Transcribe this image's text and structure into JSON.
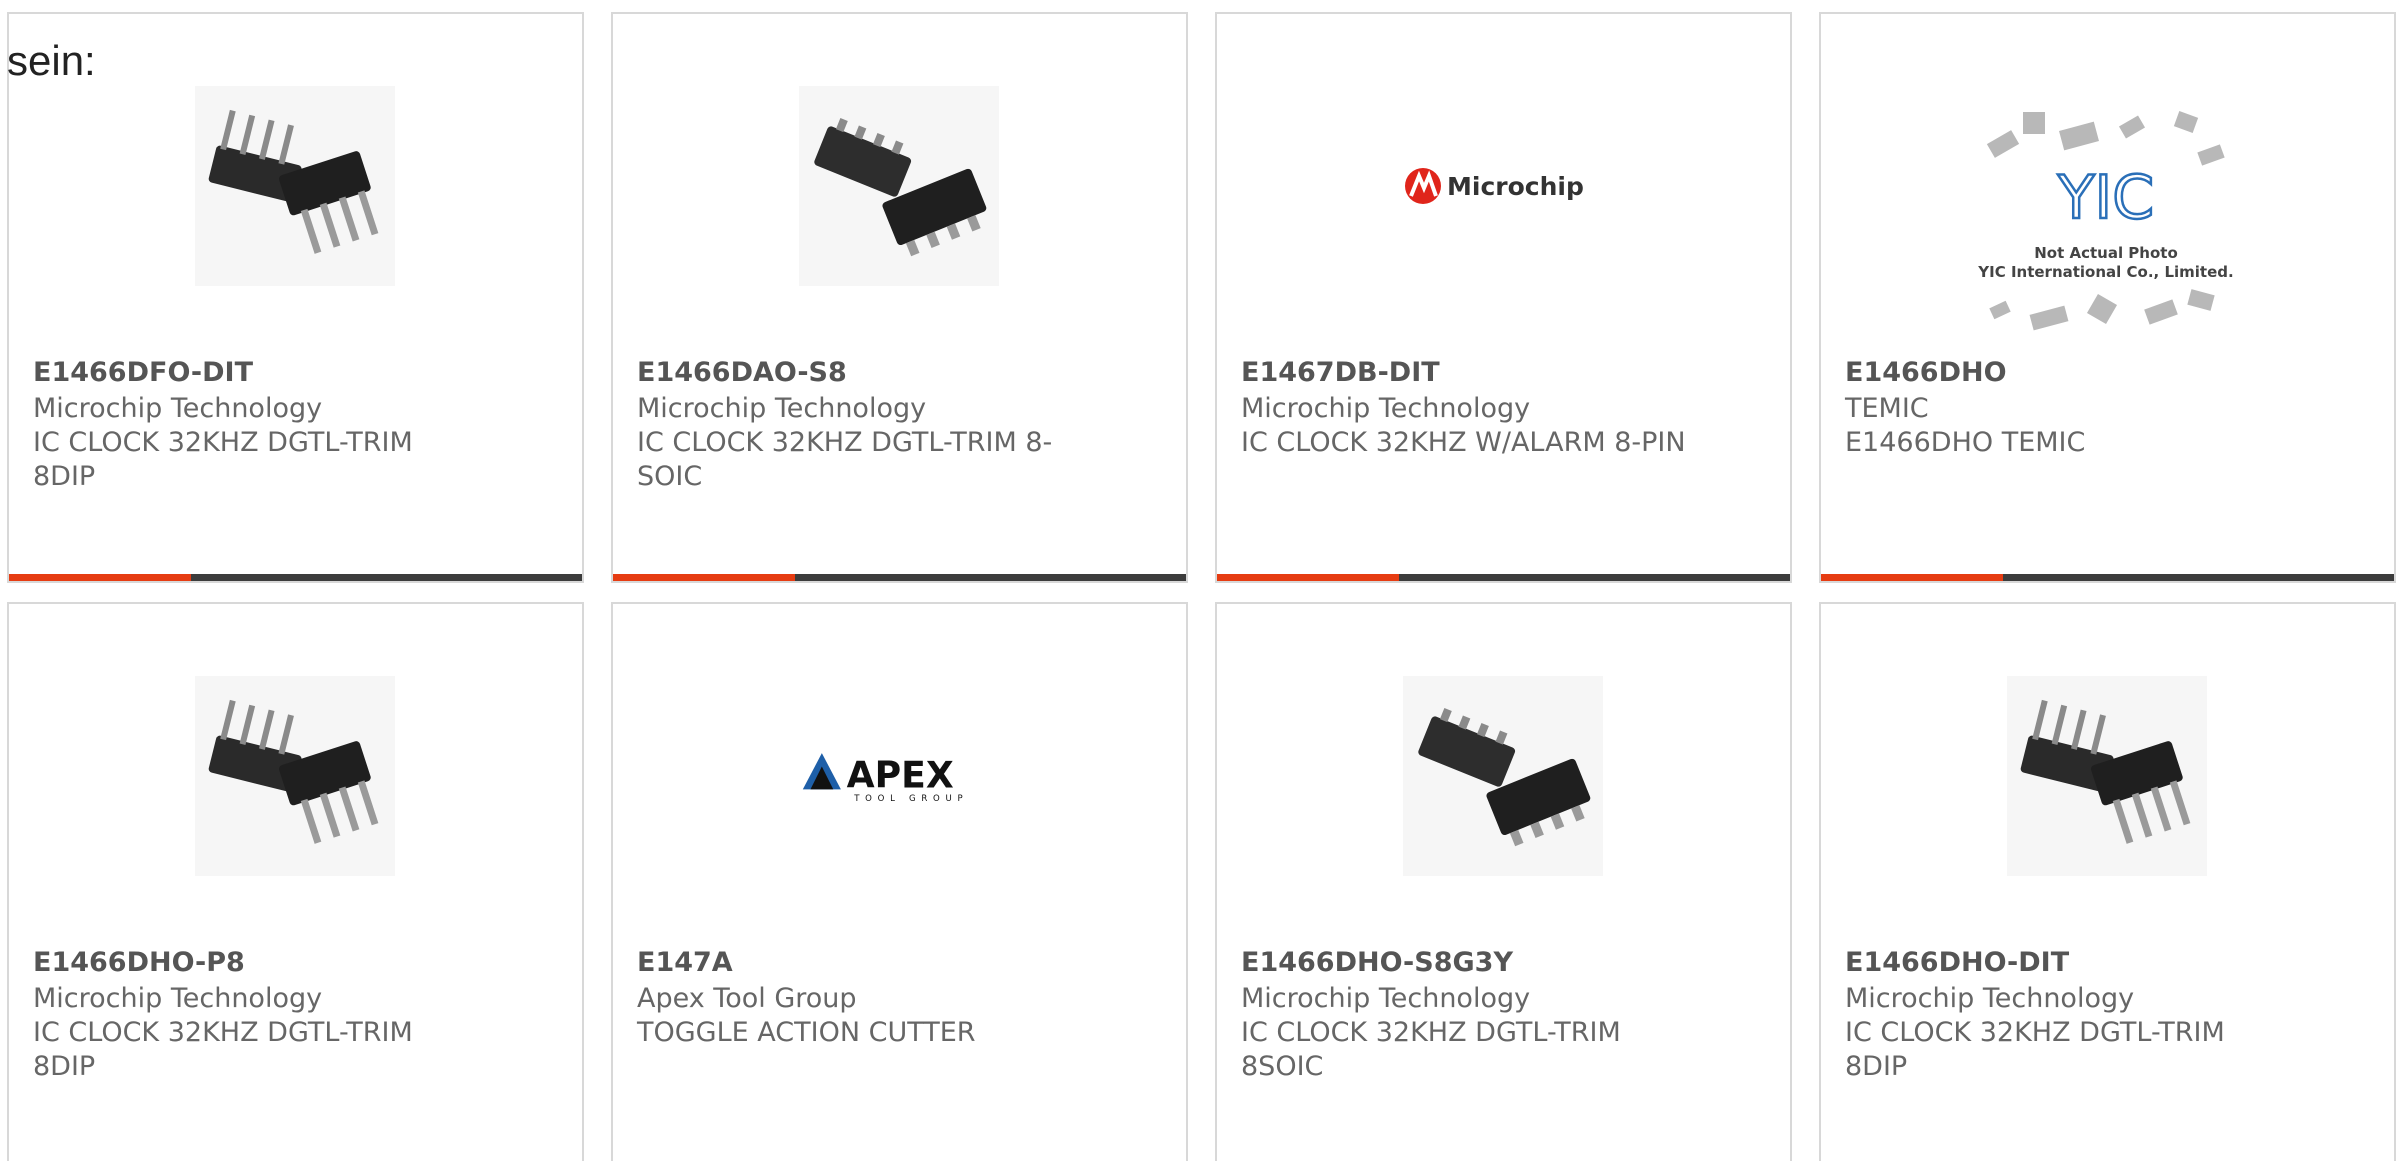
{
  "intro_label": "sein:",
  "colors": {
    "accent_bar": "#e63c12",
    "bar": "#3c3c3c",
    "card_border": "#d8d8d8"
  },
  "cards": [
    {
      "part": "E1466DFO-DIT",
      "manufacturer": "Microchip Technology",
      "desc_line1": "IC CLOCK 32KHZ DGTL-TRIM",
      "desc_line2": "8DIP",
      "image": "dip-8-chip-photo"
    },
    {
      "part": "E1466DAO-S8",
      "manufacturer": "Microchip Technology",
      "desc_line1": "IC CLOCK 32KHZ DGTL-TRIM 8-",
      "desc_line2": "SOIC",
      "image": "soic-8-chip-photo"
    },
    {
      "part": "E1467DB-DIT",
      "manufacturer": "Microchip Technology",
      "desc_line1": "IC CLOCK 32KHZ W/ALARM 8-PIN",
      "desc_line2": "",
      "image": "microchip-logo",
      "logo_text": "Microchip"
    },
    {
      "part": "E1466DHO",
      "manufacturer": "TEMIC",
      "desc_line1": "E1466DHO TEMIC",
      "desc_line2": "",
      "image": "yic-placeholder",
      "logo_text": "YIC",
      "caption_line1": "Not Actual Photo",
      "caption_line2": "YIC International Co., Limited."
    },
    {
      "part": "E1466DHO-P8",
      "manufacturer": "Microchip Technology",
      "desc_line1": "IC CLOCK 32KHZ DGTL-TRIM",
      "desc_line2": "8DIP",
      "image": "dip-8-chip-photo"
    },
    {
      "part": "E147A",
      "manufacturer": "Apex Tool Group",
      "desc_line1": "TOGGLE ACTION CUTTER",
      "desc_line2": "",
      "image": "apex-logo",
      "logo_text": "APEX",
      "logo_subtext": "TOOL GROUP"
    },
    {
      "part": "E1466DHO-S8G3Y",
      "manufacturer": "Microchip Technology",
      "desc_line1": "IC CLOCK 32KHZ DGTL-TRIM",
      "desc_line2": "8SOIC",
      "image": "soic-8-chip-photo"
    },
    {
      "part": "E1466DHO-DIT",
      "manufacturer": "Microchip Technology",
      "desc_line1": "IC CLOCK 32KHZ DGTL-TRIM",
      "desc_line2": "8DIP",
      "image": "dip-8-chip-photo"
    }
  ]
}
